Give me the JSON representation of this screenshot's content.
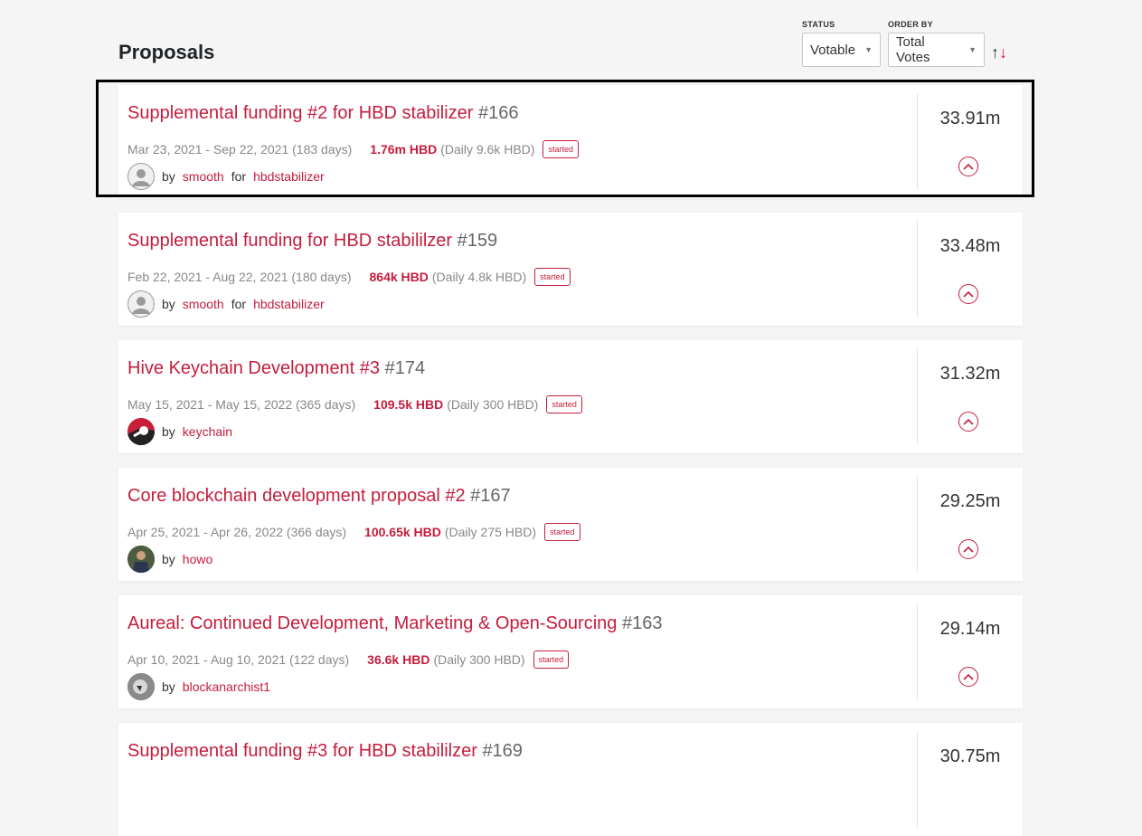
{
  "header": {
    "title": "Proposals",
    "status_label": "STATUS",
    "status_value": "Votable",
    "order_label": "ORDER BY",
    "order_value": "Total Votes",
    "sort_up": "↑",
    "sort_down": "↓"
  },
  "colors": {
    "accent": "#c51d3d",
    "brand": "#e31337"
  },
  "proposals": [
    {
      "title": "Supplemental funding #2 for HBD stabilizer",
      "id": "#166",
      "dates": "Mar 23, 2021 - Sep 22, 2021 (183 days)",
      "amount": "1.76m HBD",
      "daily": "(Daily 9.6k HBD)",
      "status": "started",
      "by": "by",
      "author": "smooth",
      "for": "for",
      "receiver": "hbdstabilizer",
      "votes": "33.91m",
      "avatar": "default-avatar"
    },
    {
      "title": "Supplemental funding for HBD stabililzer",
      "id": "#159",
      "dates": "Feb 22, 2021 - Aug 22, 2021 (180 days)",
      "amount": "864k HBD",
      "daily": "(Daily 4.8k HBD)",
      "status": "started",
      "by": "by",
      "author": "smooth",
      "for": "for",
      "receiver": "hbdstabilizer",
      "votes": "33.48m",
      "avatar": "default-avatar"
    },
    {
      "title": "Hive Keychain Development #3",
      "id": "#174",
      "dates": "May 15, 2021 - May 15, 2022 (365 days)",
      "amount": "109.5k HBD",
      "daily": "(Daily 300 HBD)",
      "status": "started",
      "by": "by",
      "author": "keychain",
      "votes": "31.32m",
      "avatar": "keychain-avatar"
    },
    {
      "title": "Core blockchain development proposal #2",
      "id": "#167",
      "dates": "Apr 25, 2021 - Apr 26, 2022 (366 days)",
      "amount": "100.65k HBD",
      "daily": "(Daily 275 HBD)",
      "status": "started",
      "by": "by",
      "author": "howo",
      "votes": "29.25m",
      "avatar": "photo-avatar"
    },
    {
      "title": "Aureal: Continued Development, Marketing & Open-Sourcing",
      "id": "#163",
      "dates": "Apr 10, 2021 - Aug 10, 2021 (122 days)",
      "amount": "36.6k HBD",
      "daily": "(Daily 300 HBD)",
      "status": "started",
      "by": "by",
      "author": "blockanarchist1",
      "votes": "29.14m",
      "avatar": "bw-avatar"
    },
    {
      "title": "Supplemental funding #3 for HBD stabililzer",
      "id": "#169",
      "votes": "30.75m"
    }
  ]
}
